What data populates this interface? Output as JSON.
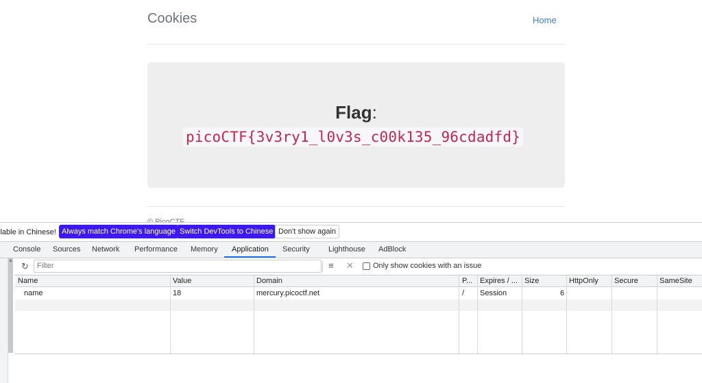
{
  "site": {
    "title": "Cookies",
    "nav_home": "Home",
    "flag_label": "Flag",
    "flag_colon": ":",
    "flag_value": "picoCTF{3v3ry1_l0v3s_c00k135_96cdadfd}",
    "footer": "© PicoCTF"
  },
  "devtools": {
    "infobar": {
      "message": "ilable in Chinese!",
      "match_language": "Always match Chrome's language",
      "switch_chinese": "Switch DevTools to Chinese",
      "dont_show": "Don't show again"
    },
    "tabs": [
      "Console",
      "Sources",
      "Network",
      "Performance",
      "Memory",
      "Application",
      "Security",
      "Lighthouse",
      "AdBlock"
    ],
    "active_tab": "Application",
    "toolbar": {
      "filter_placeholder": "Filter",
      "only_issue_label": "Only show cookies with an issue"
    },
    "columns": [
      "Name",
      "Value",
      "Domain",
      "P...",
      "Expires / ...",
      "Size",
      "HttpOnly",
      "Secure",
      "SameSite"
    ],
    "rows": [
      {
        "name": "name",
        "value": "18",
        "domain": "mercury.picoctf.net",
        "path": "/",
        "expires": "Session",
        "size": "6",
        "httponly": "",
        "secure": "",
        "samesite": ""
      }
    ],
    "icons": {
      "refresh": "refresh-icon",
      "clear_filter": "clear-filter-icon",
      "delete": "delete-icon"
    },
    "colors": {
      "accent_button": "#3d19f0",
      "tab_underline": "#1a73e8",
      "flag_text": "#c7254e"
    }
  }
}
